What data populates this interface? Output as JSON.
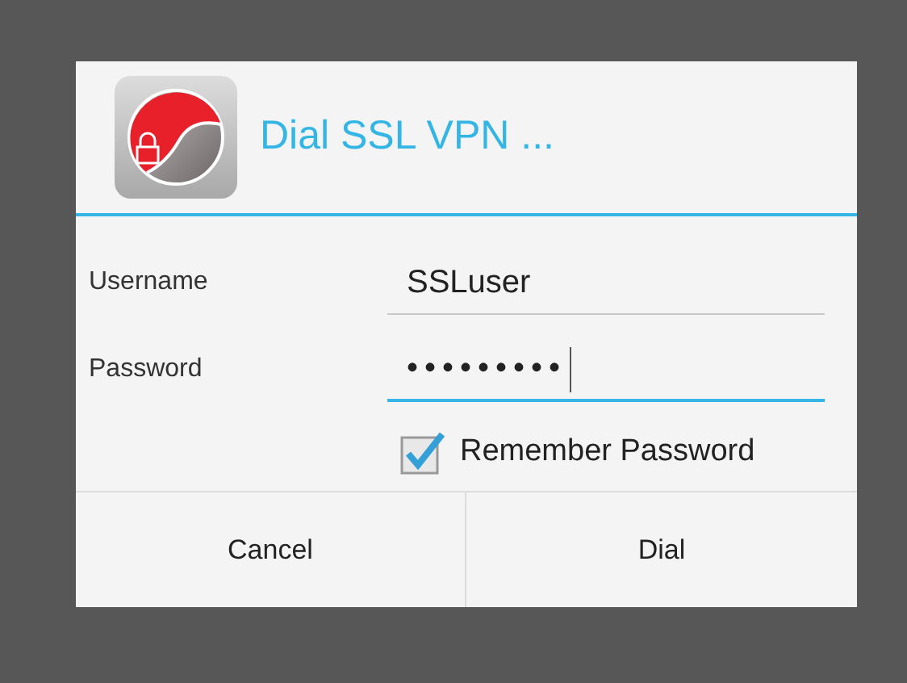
{
  "dialog": {
    "title": "Dial SSL VPN ...",
    "fields": [
      {
        "label": "Username",
        "value": "SSLuser",
        "focused": false
      },
      {
        "label": "Password",
        "value": "•••••••••",
        "focused": true
      }
    ],
    "remember_password": {
      "label": "Remember Password",
      "checked": true
    },
    "buttons": [
      "Cancel",
      "Dial"
    ]
  }
}
